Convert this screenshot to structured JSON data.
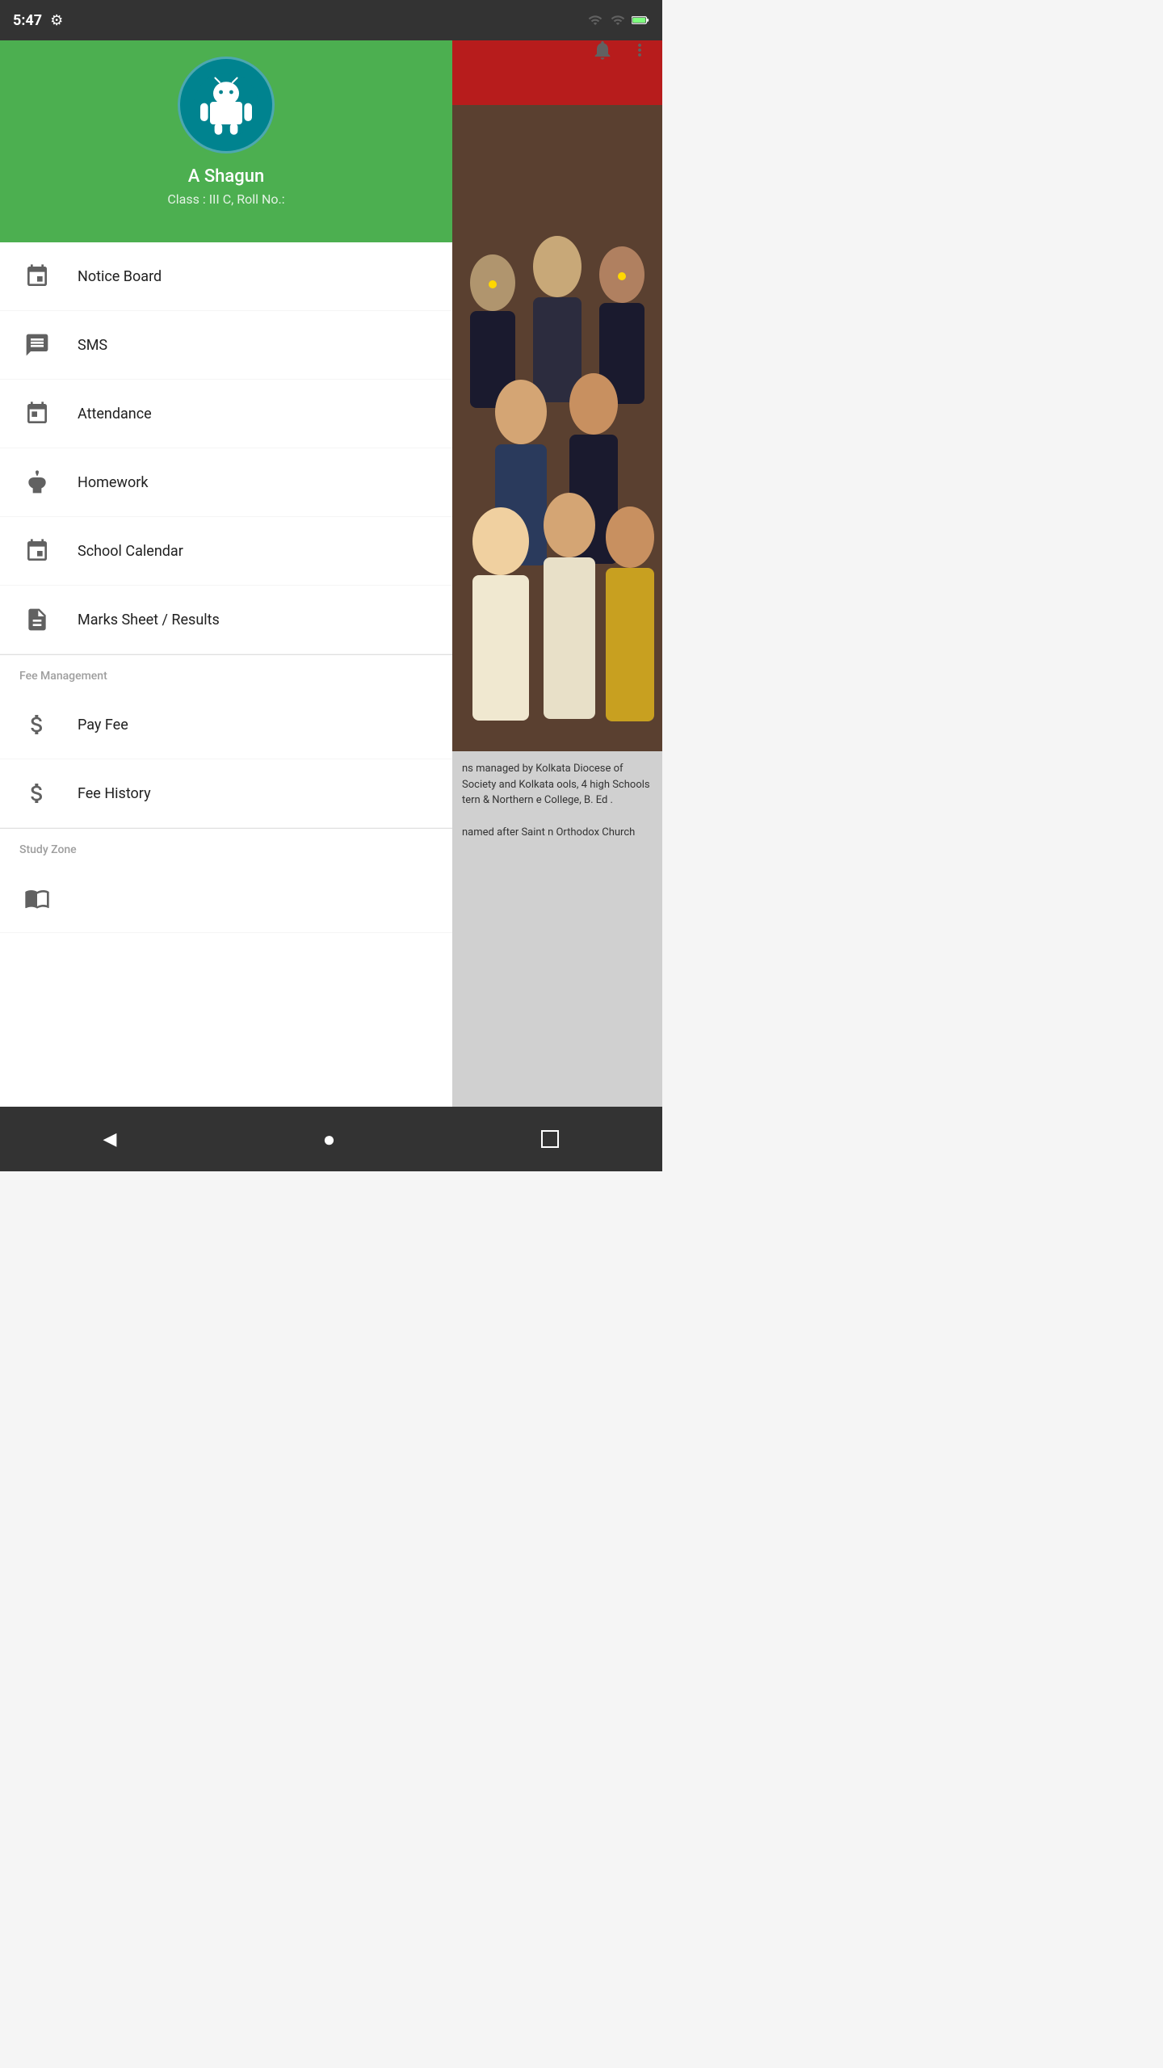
{
  "status_bar": {
    "time": "5:47",
    "settings_icon": "⚙"
  },
  "top_action_bar": {
    "notification_icon": "🔔",
    "more_icon": "⋮"
  },
  "drawer_header": {
    "user_name": "A  Shagun",
    "user_info": "Class : III C,  Roll No.:"
  },
  "menu_items": [
    {
      "id": "notice-board",
      "label": "Notice Board",
      "icon": "pin"
    },
    {
      "id": "sms",
      "label": "SMS",
      "icon": "message"
    },
    {
      "id": "attendance",
      "label": "Attendance",
      "icon": "calendar-list"
    },
    {
      "id": "homework",
      "label": "Homework",
      "icon": "homework"
    },
    {
      "id": "school-calendar",
      "label": "School Calendar",
      "icon": "calendar-grid"
    },
    {
      "id": "marks-sheet",
      "label": "Marks Sheet / Results",
      "icon": "report-card"
    }
  ],
  "fee_section": {
    "title": "Fee Management",
    "items": [
      {
        "id": "pay-fee",
        "label": "Pay Fee",
        "icon": "coins"
      },
      {
        "id": "fee-history",
        "label": "Fee History",
        "icon": "coins-history"
      }
    ]
  },
  "study_section": {
    "title": "Study Zone"
  },
  "text_content_1": "ns managed by Kolkata Diocese of Society and Kolkata ools, 4 high Schools tern & Northern e College, B. Ed .",
  "text_content_2": "named after Saint n Orthodox Church",
  "bottom_nav": {
    "back": "◀",
    "home": "●",
    "recents": "■"
  }
}
